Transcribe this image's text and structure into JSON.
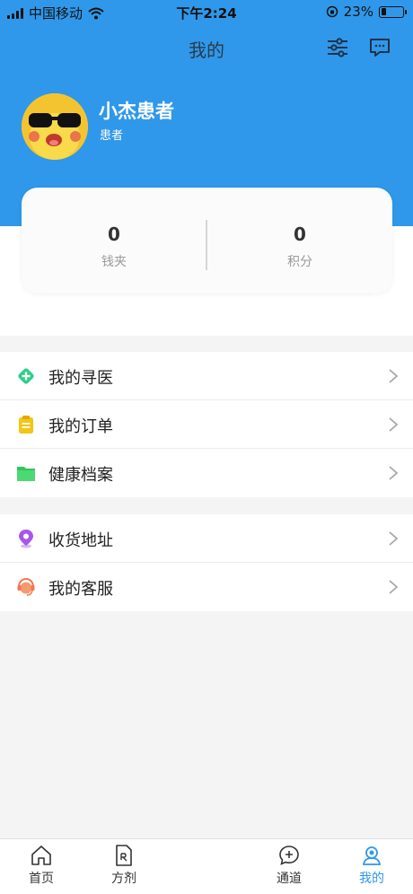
{
  "status_bar": {
    "carrier": "中国移动",
    "time": "下午2:24",
    "battery": "23%",
    "battery_level": 0.23
  },
  "nav": {
    "title": "我的",
    "filter_icon": "sliders-icon",
    "message_icon": "chat-bubble-icon"
  },
  "profile": {
    "name": "小杰患者",
    "role": "患者"
  },
  "stats": [
    {
      "value": "0",
      "label": "钱夹"
    },
    {
      "value": "0",
      "label": "积分"
    }
  ],
  "menu_group_1": [
    {
      "label": "我的寻医",
      "icon": "medical-cross-icon",
      "color": "#2fcf8a"
    },
    {
      "label": "我的订单",
      "icon": "clipboard-icon",
      "color": "#f3c515"
    },
    {
      "label": "健康档案",
      "icon": "folder-icon",
      "color": "#33c65a"
    }
  ],
  "menu_group_2": [
    {
      "label": "收货地址",
      "icon": "location-pin-icon",
      "color": "#a956e6"
    },
    {
      "label": "我的客服",
      "icon": "headset-icon",
      "color": "#f07850"
    }
  ],
  "tabbar": {
    "tabs": [
      {
        "label": "首页",
        "icon": "home-icon"
      },
      {
        "label": "方剂",
        "icon": "prescription-icon"
      },
      {
        "label": "通道",
        "icon": "add-chat-icon"
      },
      {
        "label": "我的",
        "icon": "user-icon"
      }
    ],
    "active_index": 3
  },
  "colors": {
    "primary": "#2f98ea",
    "background": "#f4f4f4"
  }
}
